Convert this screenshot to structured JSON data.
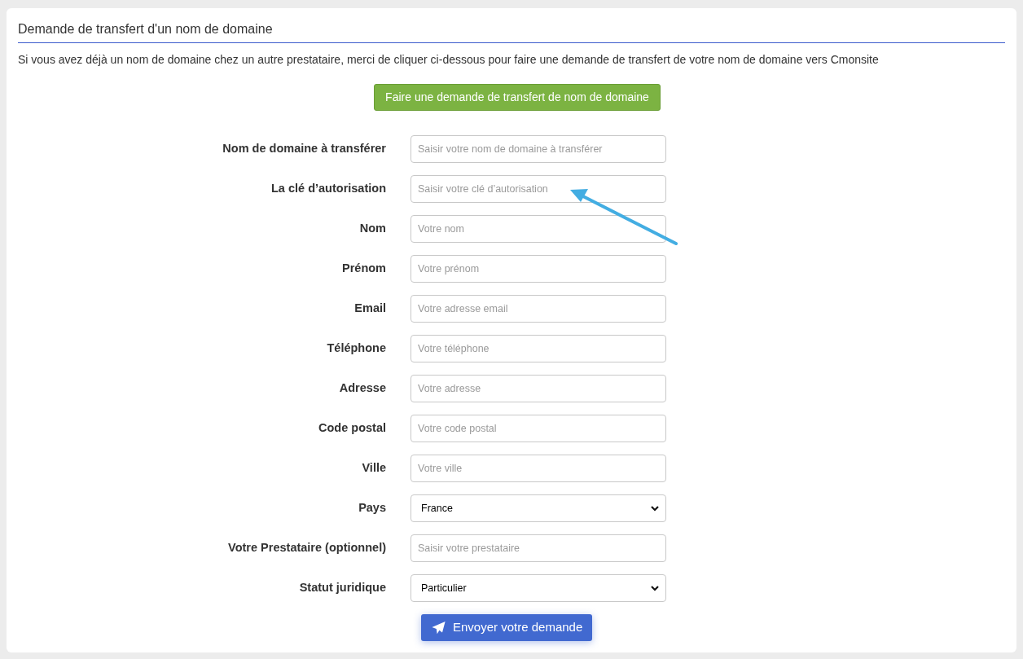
{
  "title": "Demande de transfert d'un nom de domaine",
  "intro": "Si vous avez déjà un nom de domaine chez un autre prestataire, merci de cliquer ci-dessous pour faire une demande de transfert de votre nom de domaine vers Cmonsite",
  "transfer_button": "Faire une demande de transfert de nom de domaine",
  "fields": [
    {
      "kind": "text",
      "label": "Nom de domaine à transférer",
      "placeholder": "Saisir votre nom de domaine à transférer"
    },
    {
      "kind": "text",
      "label": "La clé d’autorisation",
      "placeholder": "Saisir votre clé d’autorisation"
    },
    {
      "kind": "text",
      "label": "Nom",
      "placeholder": "Votre nom"
    },
    {
      "kind": "text",
      "label": "Prénom",
      "placeholder": "Votre prénom"
    },
    {
      "kind": "text",
      "label": "Email",
      "placeholder": "Votre adresse email"
    },
    {
      "kind": "text",
      "label": "Téléphone",
      "placeholder": "Votre téléphone"
    },
    {
      "kind": "text",
      "label": "Adresse",
      "placeholder": "Votre adresse"
    },
    {
      "kind": "text",
      "label": "Code postal",
      "placeholder": "Votre code postal"
    },
    {
      "kind": "text",
      "label": "Ville",
      "placeholder": "Votre ville"
    },
    {
      "kind": "select",
      "label": "Pays",
      "value": "France"
    },
    {
      "kind": "text",
      "label": "Votre Prestataire (optionnel)",
      "placeholder": "Saisir votre prestataire"
    },
    {
      "kind": "select",
      "label": "Statut juridique",
      "value": "Particulier"
    }
  ],
  "submit_button": "Envoyer votre demande"
}
